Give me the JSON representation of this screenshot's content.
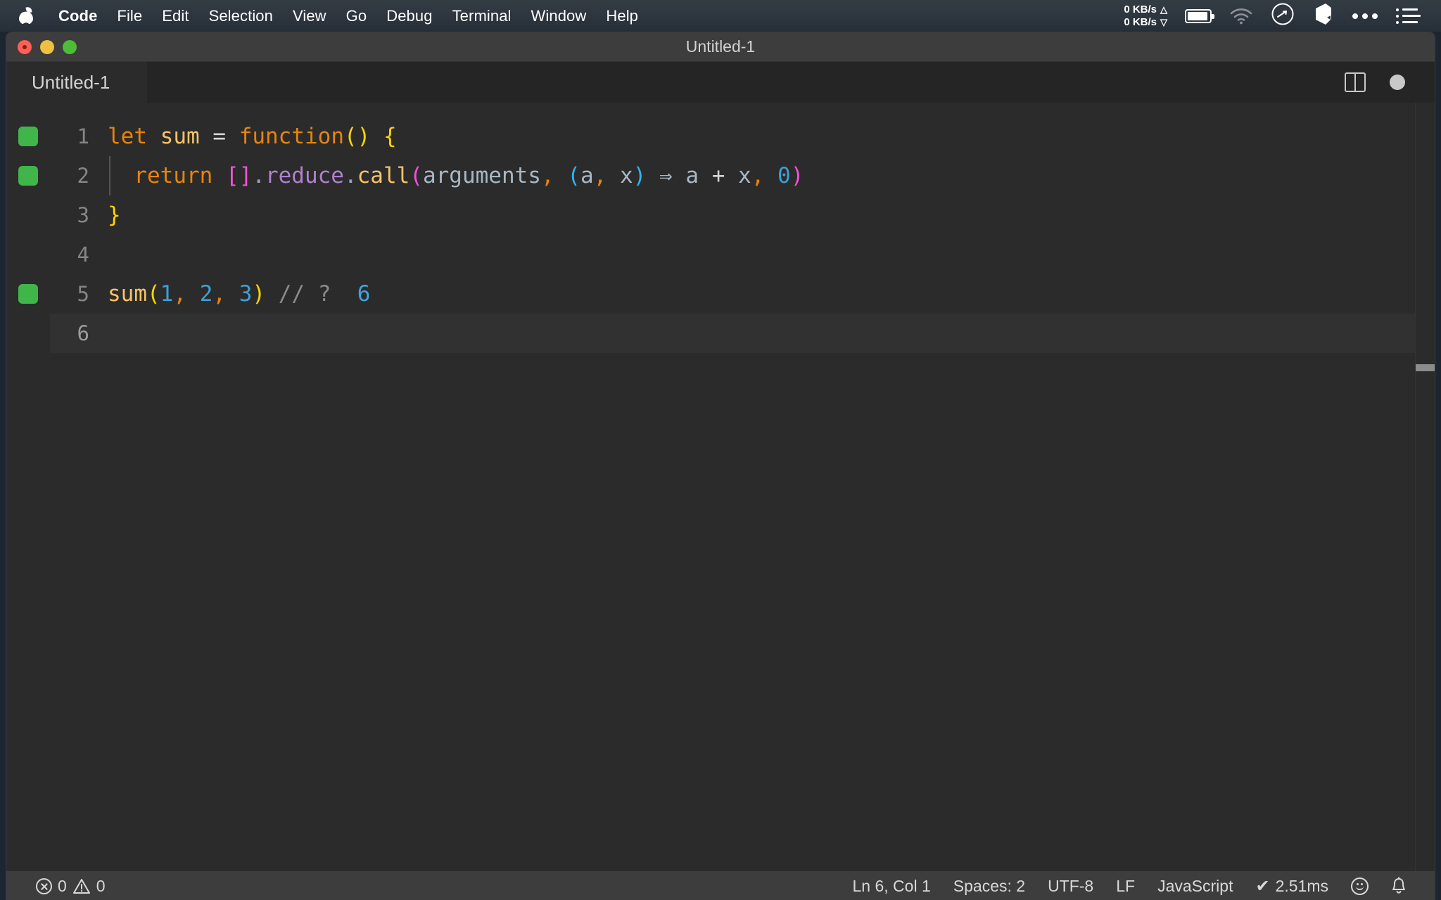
{
  "menubar": {
    "apple_icon": "apple-logo-icon",
    "items": [
      {
        "label": "Code",
        "bold": true
      },
      {
        "label": "File",
        "bold": false
      },
      {
        "label": "Edit",
        "bold": false
      },
      {
        "label": "Selection",
        "bold": false
      },
      {
        "label": "View",
        "bold": false
      },
      {
        "label": "Go",
        "bold": false
      },
      {
        "label": "Debug",
        "bold": false
      },
      {
        "label": "Terminal",
        "bold": false
      },
      {
        "label": "Window",
        "bold": false
      },
      {
        "label": "Help",
        "bold": false
      }
    ],
    "tray": {
      "net_up": "0 KB/s",
      "net_down": "0 KB/s",
      "up_arrow": "△",
      "down_arrow": "▽",
      "battery_icon": "battery-icon",
      "wifi_icon": "wifi-icon",
      "compass_icon": "compass-icon",
      "cube_icon": "cube-icon",
      "overflow_icon": "three-dots-icon",
      "list_icon": "control-center-list-icon"
    }
  },
  "window": {
    "title": "Untitled-1",
    "traffic_lights": [
      "close",
      "minimize",
      "maximize"
    ]
  },
  "tabbar": {
    "tabs": [
      {
        "label": "Untitled-1",
        "active": true,
        "dirty": true
      }
    ],
    "split_editor_icon": "split-editor-icon",
    "dirty_indicator_icon": "unsaved-dot-icon"
  },
  "editor": {
    "language": "JavaScript",
    "lines": [
      {
        "number": "1",
        "coverage": true,
        "current": false,
        "indent_guide": false,
        "tokens": [
          {
            "text": "let",
            "cls": "t-keyword"
          },
          {
            "text": " ",
            "cls": "t-plain"
          },
          {
            "text": "sum",
            "cls": "t-var"
          },
          {
            "text": " ",
            "cls": "t-plain"
          },
          {
            "text": "=",
            "cls": "t-operator"
          },
          {
            "text": " ",
            "cls": "t-plain"
          },
          {
            "text": "function",
            "cls": "t-fnkw"
          },
          {
            "text": "()",
            "cls": "t-paren-y"
          },
          {
            "text": " ",
            "cls": "t-plain"
          },
          {
            "text": "{",
            "cls": "t-brace-y"
          }
        ]
      },
      {
        "number": "2",
        "coverage": true,
        "current": false,
        "indent_guide": true,
        "tokens": [
          {
            "text": "  ",
            "cls": "t-plain"
          },
          {
            "text": "return",
            "cls": "t-keyword"
          },
          {
            "text": " ",
            "cls": "t-plain"
          },
          {
            "text": "[]",
            "cls": "t-paren-m"
          },
          {
            "text": ".",
            "cls": "t-dot"
          },
          {
            "text": "reduce",
            "cls": "t-prop"
          },
          {
            "text": ".",
            "cls": "t-dot"
          },
          {
            "text": "call",
            "cls": "t-call"
          },
          {
            "text": "(",
            "cls": "t-paren-m"
          },
          {
            "text": "arguments",
            "cls": "t-ident"
          },
          {
            "text": ",",
            "cls": "t-comma"
          },
          {
            "text": " ",
            "cls": "t-plain"
          },
          {
            "text": "(",
            "cls": "t-paren-c"
          },
          {
            "text": "a",
            "cls": "t-ident"
          },
          {
            "text": ",",
            "cls": "t-comma"
          },
          {
            "text": " ",
            "cls": "t-plain"
          },
          {
            "text": "x",
            "cls": "t-ident"
          },
          {
            "text": ")",
            "cls": "t-paren-c"
          },
          {
            "text": " ",
            "cls": "t-plain"
          },
          {
            "text": "⇒",
            "cls": "t-arrow"
          },
          {
            "text": " ",
            "cls": "t-plain"
          },
          {
            "text": "a",
            "cls": "t-ident"
          },
          {
            "text": " ",
            "cls": "t-plain"
          },
          {
            "text": "+",
            "cls": "t-operator"
          },
          {
            "text": " ",
            "cls": "t-plain"
          },
          {
            "text": "x",
            "cls": "t-ident"
          },
          {
            "text": ",",
            "cls": "t-comma"
          },
          {
            "text": " ",
            "cls": "t-plain"
          },
          {
            "text": "0",
            "cls": "t-num"
          },
          {
            "text": ")",
            "cls": "t-paren-m"
          }
        ]
      },
      {
        "number": "3",
        "coverage": false,
        "current": false,
        "indent_guide": false,
        "tokens": [
          {
            "text": "}",
            "cls": "t-brace-y"
          }
        ]
      },
      {
        "number": "4",
        "coverage": false,
        "current": false,
        "indent_guide": false,
        "tokens": []
      },
      {
        "number": "5",
        "coverage": true,
        "current": false,
        "indent_guide": false,
        "tokens": [
          {
            "text": "sum",
            "cls": "t-var"
          },
          {
            "text": "(",
            "cls": "t-paren-y"
          },
          {
            "text": "1",
            "cls": "t-num"
          },
          {
            "text": ",",
            "cls": "t-comma"
          },
          {
            "text": " ",
            "cls": "t-plain"
          },
          {
            "text": "2",
            "cls": "t-num"
          },
          {
            "text": ",",
            "cls": "t-comma"
          },
          {
            "text": " ",
            "cls": "t-plain"
          },
          {
            "text": "3",
            "cls": "t-num"
          },
          {
            "text": ")",
            "cls": "t-paren-y"
          },
          {
            "text": " ",
            "cls": "t-plain"
          },
          {
            "text": "// ?",
            "cls": "t-comment"
          },
          {
            "text": "  ",
            "cls": "t-plain"
          },
          {
            "text": "6",
            "cls": "t-numlight"
          }
        ]
      },
      {
        "number": "6",
        "coverage": false,
        "current": true,
        "indent_guide": false,
        "tokens": []
      }
    ]
  },
  "statusbar": {
    "error_icon": "error-circle-icon",
    "error_count": "0",
    "warning_icon": "warning-triangle-icon",
    "warning_count": "0",
    "cursor_position": "Ln 6, Col 1",
    "indentation": "Spaces: 2",
    "encoding": "UTF-8",
    "eol": "LF",
    "language_mode": "JavaScript",
    "run_check": "✔",
    "run_time": "2.51ms",
    "feedback_icon": "smiley-icon",
    "notifications_icon": "bell-icon"
  },
  "colors": {
    "menubar_bg": "#2f3740",
    "titlebar_bg": "#3d3d3d",
    "editor_bg": "#2b2b2b",
    "tabbar_bg": "#252526",
    "statusbar_bg": "#3d3d3d",
    "coverage_green": "#3fb54a",
    "keyword_orange": "#e8830c",
    "variable_gold": "#f6c368",
    "paren_yellow": "#ffd400",
    "paren_magenta": "#f552d8",
    "paren_cyan": "#2fb3ef",
    "property_purple": "#b080d0",
    "number_blue": "#3f9fd4",
    "comment_grey": "#8a8a8a",
    "traffic_close": "#ff5f57",
    "traffic_min": "#f0c040",
    "traffic_max": "#4cbd35"
  }
}
